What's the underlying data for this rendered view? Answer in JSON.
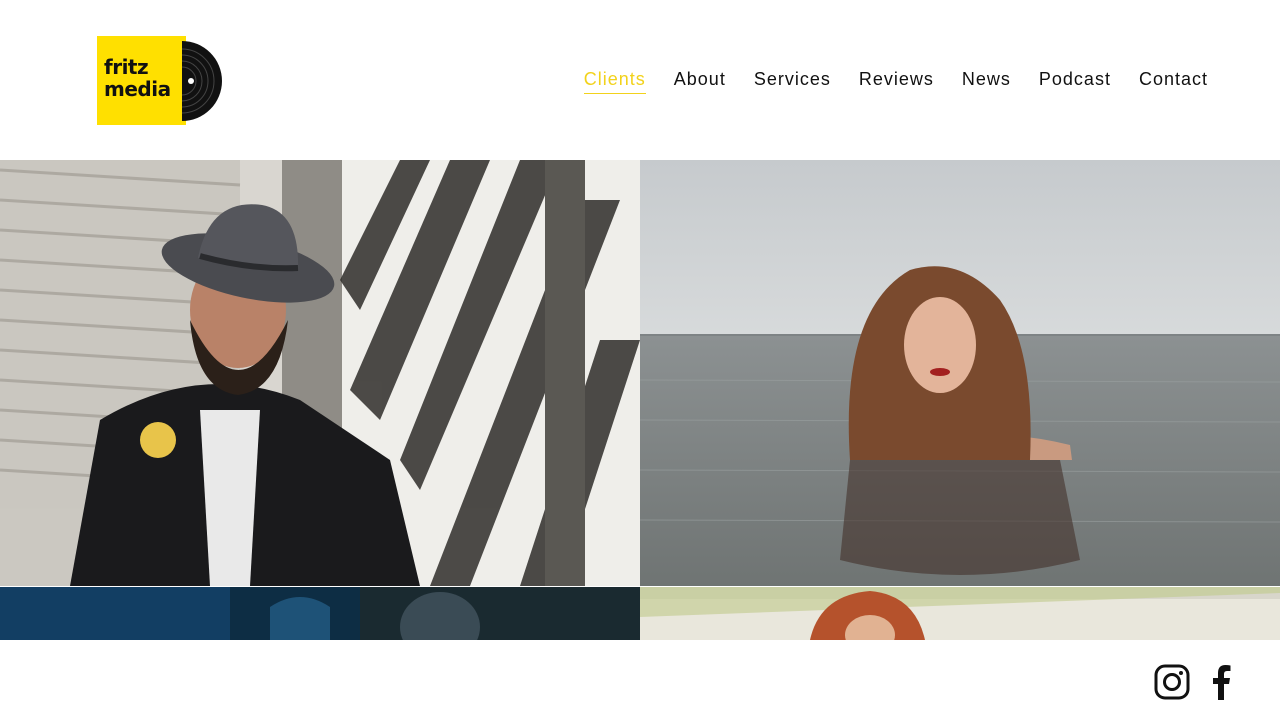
{
  "brand": {
    "logo_line1": "fritz",
    "logo_line2": "media",
    "accent_color": "#ffe000"
  },
  "nav": {
    "items": [
      {
        "label": "Clients",
        "active": true
      },
      {
        "label": "About"
      },
      {
        "label": "Services"
      },
      {
        "label": "Reviews"
      },
      {
        "label": "News"
      },
      {
        "label": "Podcast"
      },
      {
        "label": "Contact"
      }
    ]
  },
  "gallery": {
    "tiles": [
      {
        "icon": "photo-man-with-hat"
      },
      {
        "icon": "photo-woman-in-water"
      },
      {
        "icon": "photo-performer-blue-stage"
      },
      {
        "icon": "photo-woman-red-hair"
      }
    ]
  },
  "footer": {
    "social": [
      {
        "icon": "instagram-icon"
      },
      {
        "icon": "facebook-icon"
      }
    ]
  }
}
